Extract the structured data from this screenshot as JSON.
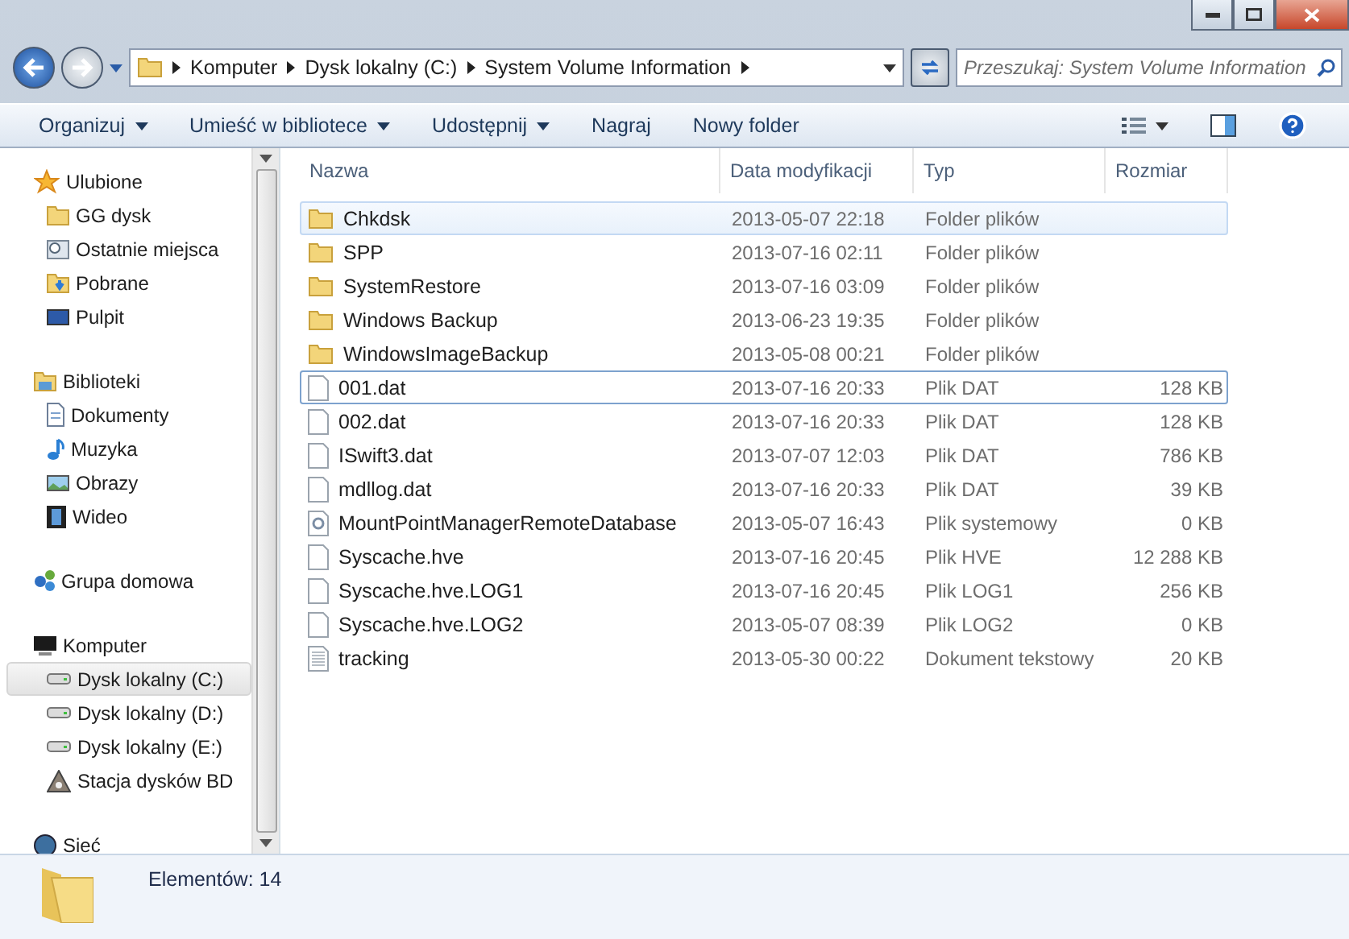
{
  "address_bar": {
    "crumbs": [
      "Komputer",
      "Dysk lokalny (C:)",
      "System Volume Information"
    ]
  },
  "search": {
    "placeholder": "Przeszukaj: System Volume Information"
  },
  "toolbar": {
    "buttons": [
      {
        "label": "Organizuj",
        "dropdown": true
      },
      {
        "label": "Umieść w bibliotece",
        "dropdown": true
      },
      {
        "label": "Udostępnij",
        "dropdown": true
      },
      {
        "label": "Nagraj",
        "dropdown": false
      },
      {
        "label": "Nowy folder",
        "dropdown": false
      }
    ]
  },
  "navigation": {
    "groups": [
      {
        "label": "Ulubione",
        "children": [
          {
            "label": "GG dysk",
            "selected": false
          },
          {
            "label": "Ostatnie miejsca",
            "selected": false
          },
          {
            "label": "Pobrane",
            "selected": false
          },
          {
            "label": "Pulpit",
            "selected": false
          }
        ]
      },
      {
        "label": "Biblioteki",
        "children": [
          {
            "label": "Dokumenty",
            "selected": false
          },
          {
            "label": "Muzyka",
            "selected": false
          },
          {
            "label": "Obrazy",
            "selected": false
          },
          {
            "label": "Wideo",
            "selected": false
          }
        ]
      },
      {
        "label": "Grupa domowa"
      },
      {
        "label": "Komputer",
        "children": [
          {
            "label": "Dysk lokalny (C:)",
            "selected": true
          },
          {
            "label": "Dysk lokalny (D:)",
            "selected": false
          },
          {
            "label": "Dysk lokalny (E:)",
            "selected": false
          },
          {
            "label": "Stacja dysków BD",
            "selected": false
          }
        ]
      },
      {
        "label": "Sieć"
      }
    ]
  },
  "table": {
    "columns": [
      "Nazwa",
      "Data modyfikacji",
      "Typ",
      "Rozmiar"
    ],
    "rows": [
      {
        "kind": "folder",
        "name": "Chkdsk",
        "modified": "2013-05-07 22:18",
        "type": "Folder plików",
        "selected": true,
        "focused": false
      },
      {
        "kind": "folder",
        "name": "SPP",
        "modified": "2013-07-16 02:11",
        "type": "Folder plików",
        "selected": false,
        "focused": false
      },
      {
        "kind": "folder",
        "name": "SystemRestore",
        "modified": "2013-07-16 03:09",
        "type": "Folder plików",
        "selected": false,
        "focused": false
      },
      {
        "kind": "folder",
        "name": "Windows Backup",
        "modified": "2013-06-23 19:35",
        "type": "Folder plików",
        "selected": false,
        "focused": false
      },
      {
        "kind": "folder",
        "name": "WindowsImageBackup",
        "modified": "2013-05-08 00:21",
        "type": "Folder plików",
        "selected": false,
        "focused": false
      },
      {
        "kind": "file",
        "name": "001.dat",
        "modified": "2013-07-16 20:33",
        "type": "Plik DAT",
        "size": "128 KB",
        "selected": false,
        "focused": true
      },
      {
        "kind": "file",
        "name": "002.dat",
        "modified": "2013-07-16 20:33",
        "type": "Plik DAT",
        "size": "128 KB",
        "selected": false,
        "focused": false
      },
      {
        "kind": "file",
        "name": "ISwift3.dat",
        "modified": "2013-07-07 12:03",
        "type": "Plik DAT",
        "size": "786 KB",
        "selected": false,
        "focused": false
      },
      {
        "kind": "file",
        "name": "mdllog.dat",
        "modified": "2013-07-16 20:33",
        "type": "Plik DAT",
        "size": "39 KB",
        "selected": false,
        "focused": false
      },
      {
        "kind": "system",
        "name": "MountPointManagerRemoteDatabase",
        "modified": "2013-05-07 16:43",
        "type": "Plik systemowy",
        "size": "0 KB",
        "selected": false,
        "focused": false
      },
      {
        "kind": "file",
        "name": "Syscache.hve",
        "modified": "2013-07-16 20:45",
        "type": "Plik HVE",
        "size": "12 288 KB",
        "selected": false,
        "focused": false
      },
      {
        "kind": "file",
        "name": "Syscache.hve.LOG1",
        "modified": "2013-07-16 20:45",
        "type": "Plik LOG1",
        "size": "256 KB",
        "selected": false,
        "focused": false
      },
      {
        "kind": "file",
        "name": "Syscache.hve.LOG2",
        "modified": "2013-05-07 08:39",
        "type": "Plik LOG2",
        "size": "0 KB",
        "selected": false,
        "focused": false
      },
      {
        "kind": "text",
        "name": "tracking",
        "modified": "2013-05-30 00:22",
        "type": "Dokument tekstowy",
        "size": "20 KB",
        "selected": false,
        "focused": false
      }
    ]
  },
  "status_bar": {
    "text": "Elementów: 14"
  }
}
